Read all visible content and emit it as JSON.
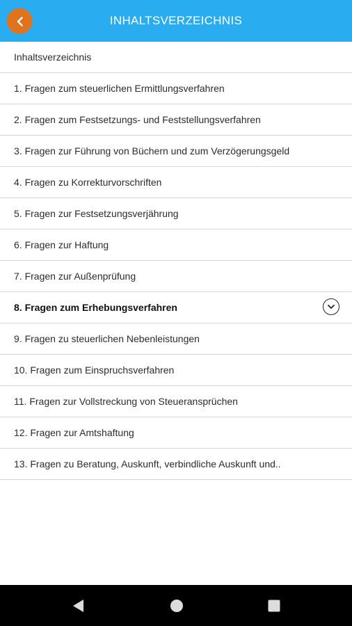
{
  "header": {
    "title": "INHALTSVERZEICHNIS",
    "back_icon": "chevron-left-icon",
    "accent_color": "#29adf0",
    "back_button_color": "#e0731d"
  },
  "toc": {
    "items": [
      {
        "label": "Inhaltsverzeichnis"
      },
      {
        "label": "1. Fragen zum steuerlichen Ermittlungsverfahren"
      },
      {
        "label": "2. Fragen zum Festsetzungs- und Feststellungsverfahren"
      },
      {
        "label": "3. Fragen zur Führung von Büchern und zum Verzögerungsgeld"
      },
      {
        "label": "4. Fragen zu Korrekturvorschriften"
      },
      {
        "label": "5. Fragen zur Festsetzungsverjährung"
      },
      {
        "label": "6. Fragen zur Haftung"
      },
      {
        "label": "7. Fragen zur Außenprüfung"
      },
      {
        "label": "8. Fragen zum Erhebungsverfahren",
        "active": true,
        "icon": "chevron-down-circle-icon"
      },
      {
        "label": "9. Fragen zu steuerlichen Nebenleistungen"
      },
      {
        "label": "10. Fragen zum Einspruchsverfahren"
      },
      {
        "label": "11. Fragen zur Vollstreckung von Steueransprüchen"
      },
      {
        "label": "12. Fragen zur Amtshaftung"
      },
      {
        "label": "13. Fragen zu Beratung, Auskunft, verbindliche Auskunft und.."
      }
    ]
  },
  "navbar": {
    "icons": [
      "nav-back-icon",
      "nav-home-icon",
      "nav-recents-icon"
    ]
  }
}
